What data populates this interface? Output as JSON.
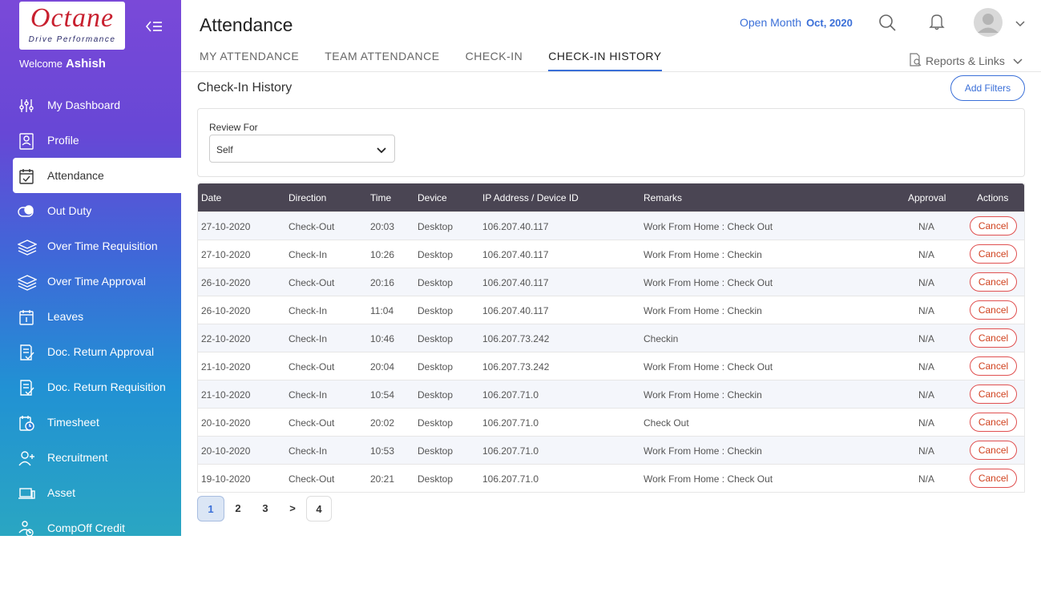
{
  "brand": {
    "logo_text": "Octane",
    "tagline": "Drive Performance"
  },
  "user": {
    "welcome_label": "Welcome",
    "name": "Ashish"
  },
  "sidebar": {
    "items": [
      {
        "label": "My Dashboard",
        "icon": "sliders-icon"
      },
      {
        "label": "Profile",
        "icon": "id-card-icon"
      },
      {
        "label": "Attendance",
        "icon": "calendar-check-icon",
        "active": true
      },
      {
        "label": "Out Duty",
        "icon": "toggle-icon"
      },
      {
        "label": "Over Time Requisition",
        "icon": "layers-icon"
      },
      {
        "label": "Over Time Approval",
        "icon": "layers-icon"
      },
      {
        "label": "Leaves",
        "icon": "calendar-icon"
      },
      {
        "label": "Doc. Return Approval",
        "icon": "document-check-icon"
      },
      {
        "label": "Doc. Return Requisition",
        "icon": "document-check-icon"
      },
      {
        "label": "Timesheet",
        "icon": "timesheet-icon"
      },
      {
        "label": "Recruitment",
        "icon": "add-user-icon"
      },
      {
        "label": "Asset",
        "icon": "laptop-icon"
      },
      {
        "label": "CompOff Credit",
        "icon": "users-clock-icon"
      }
    ]
  },
  "header": {
    "title": "Attendance",
    "open_month_label": "Open Month",
    "open_month_value": "Oct, 2020",
    "tabs": [
      {
        "label": "MY ATTENDANCE"
      },
      {
        "label": "TEAM ATTENDANCE"
      },
      {
        "label": "CHECK-IN"
      },
      {
        "label": "CHECK-IN HISTORY",
        "active": true
      }
    ],
    "reports_label": "Reports & Links"
  },
  "section": {
    "title": "Check-In History",
    "add_filters_label": "Add Filters"
  },
  "filter": {
    "review_for_label": "Review For",
    "review_for_value": "Self"
  },
  "table": {
    "columns": [
      "Date",
      "Direction",
      "Time",
      "Device",
      "IP Address / Device ID",
      "Remarks",
      "Approval",
      "Actions"
    ],
    "rows": [
      {
        "date": "27-10-2020",
        "direction": "Check-Out",
        "time": "20:03",
        "device": "Desktop",
        "ip": "106.207.40.117",
        "remarks": "Work From Home : Check Out",
        "approval": "N/A",
        "action": "Cancel"
      },
      {
        "date": "27-10-2020",
        "direction": "Check-In",
        "time": "10:26",
        "device": "Desktop",
        "ip": "106.207.40.117",
        "remarks": "Work From Home : Checkin",
        "approval": "N/A",
        "action": "Cancel"
      },
      {
        "date": "26-10-2020",
        "direction": "Check-Out",
        "time": "20:16",
        "device": "Desktop",
        "ip": "106.207.40.117",
        "remarks": "Work From Home : Check Out",
        "approval": "N/A",
        "action": "Cancel"
      },
      {
        "date": "26-10-2020",
        "direction": "Check-In",
        "time": "11:04",
        "device": "Desktop",
        "ip": "106.207.40.117",
        "remarks": "Work From Home : Checkin",
        "approval": "N/A",
        "action": "Cancel"
      },
      {
        "date": "22-10-2020",
        "direction": "Check-In",
        "time": "10:46",
        "device": "Desktop",
        "ip": "106.207.73.242",
        "remarks": "Checkin",
        "approval": "N/A",
        "action": "Cancel"
      },
      {
        "date": "21-10-2020",
        "direction": "Check-Out",
        "time": "20:04",
        "device": "Desktop",
        "ip": "106.207.73.242",
        "remarks": "Work From Home : Check Out",
        "approval": "N/A",
        "action": "Cancel"
      },
      {
        "date": "21-10-2020",
        "direction": "Check-In",
        "time": "10:54",
        "device": "Desktop",
        "ip": "106.207.71.0",
        "remarks": "Work From Home : Checkin",
        "approval": "N/A",
        "action": "Cancel"
      },
      {
        "date": "20-10-2020",
        "direction": "Check-Out",
        "time": "20:02",
        "device": "Desktop",
        "ip": "106.207.71.0",
        "remarks": "Check Out",
        "approval": "N/A",
        "action": "Cancel"
      },
      {
        "date": "20-10-2020",
        "direction": "Check-In",
        "time": "10:53",
        "device": "Desktop",
        "ip": "106.207.71.0",
        "remarks": "Work From Home : Checkin",
        "approval": "N/A",
        "action": "Cancel"
      },
      {
        "date": "19-10-2020",
        "direction": "Check-Out",
        "time": "20:21",
        "device": "Desktop",
        "ip": "106.207.71.0",
        "remarks": "Work From Home : Check Out",
        "approval": "N/A",
        "action": "Cancel"
      }
    ]
  },
  "pagination": {
    "pages": [
      "1",
      "2",
      "3"
    ],
    "next": ">",
    "last": "4",
    "current": "1"
  },
  "colors": {
    "accent": "#3a6fd8",
    "table_header": "#4a4553",
    "cancel": "#e05050",
    "sidebar_top": "#7a49d8",
    "sidebar_bottom": "#2aa6c2"
  }
}
